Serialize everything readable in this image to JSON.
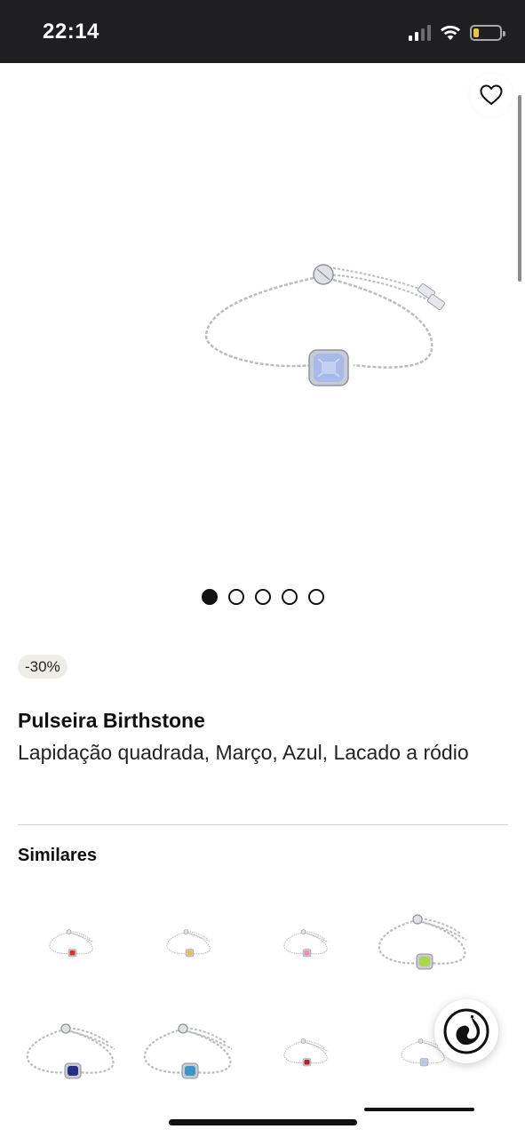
{
  "status_bar": {
    "time": "22:14",
    "icons": [
      "signal-icon",
      "wifi-icon",
      "battery-icon"
    ]
  },
  "gallery": {
    "wishlist_icon": "heart-outline-icon",
    "image": "bracelet-blue-crystal",
    "image_count": 5,
    "active_index": 0
  },
  "product": {
    "discount": "-30%",
    "name": "Pulseira Birthstone",
    "description": "Lapidação quadrada, Março, Azul, Lacado a ródio"
  },
  "similares": {
    "title": "Similares",
    "items": [
      {
        "name": "bracelet-red",
        "stone_color": "#e0321f",
        "size": "small"
      },
      {
        "name": "bracelet-yellow",
        "stone_color": "#eebb45",
        "size": "small"
      },
      {
        "name": "bracelet-pink",
        "stone_color": "#ee8fb2",
        "size": "small"
      },
      {
        "name": "bracelet-green",
        "stone_color": "#a9d84a",
        "size": "large"
      },
      {
        "name": "bracelet-dark-blue",
        "stone_color": "#27307e",
        "size": "large"
      },
      {
        "name": "bracelet-aqua",
        "stone_color": "#3a96c8",
        "size": "large"
      },
      {
        "name": "bracelet-dark-red",
        "stone_color": "#b3242a",
        "size": "small"
      },
      {
        "name": "bracelet-light-blue",
        "stone_color": "#b9c5ee",
        "size": "small"
      }
    ]
  },
  "colors": {
    "status_bar_bg": "#1f1f22",
    "battery": "#e9c43a",
    "badge_bg": "#efede7",
    "main_stone": "#a9b9ea"
  },
  "floating_button": {
    "icon": "swan-logo-icon"
  }
}
